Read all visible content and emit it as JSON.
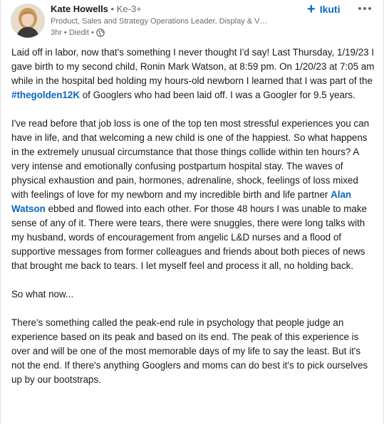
{
  "post": {
    "author": {
      "name": "Kate Howells",
      "degree": "• Ke-3+",
      "headline": "Product, Sales and Strategy Operations Leader, Display & Vide...",
      "time": "3hr",
      "edited": "• Diedit •",
      "avatar_icon": "profile-photo"
    },
    "follow_label": "Ikuti",
    "more_icon": "ellipsis-icon",
    "paragraphs": {
      "p1_a": "Laid off in labor, now that's something I never thought I'd say! Last Thursday, 1/19/23 I gave birth to my second child, Ronin Mark Watson, at 8:59 pm. On 1/20/23 at 7:05 am while in the hospital bed holding my hours-old newborn I learned that I was part of the ",
      "p1_hashtag": "#thegolden12K",
      "p1_b": " of Googlers who had been laid off. I was a Googler for 9.5 years.",
      "p2_a": "I've read before that job loss is one of the top ten most stressful experiences you can have in life, and that welcoming a new child is one of the happiest. So what happens in the extremely unusual circumstance that those things collide within ten hours? A very intense and emotionally confusing postpartum hospital stay. The waves of physical exhaustion and pain, hormones, adrenaline, shock, feelings of loss mixed with feelings of love for my newborn and my incredible birth and life partner ",
      "p2_mention": "Alan Watson",
      "p2_b": " ebbed and flowed into each other. For those 48 hours I was unable to make sense of any of it. There were tears, there were snuggles, there were long talks with my husband, words of encouragement from angelic L&D nurses and a flood of supportive messages from former colleagues and friends about both pieces of news that brought me back to tears. I let myself feel and process it all, no holding back.",
      "p3": "So what now...",
      "p4": "There's something called the peak-end rule in psychology that people judge an experience based on its peak and based on its end. The peak of this experience is over and will be one of the most memorable days of my life to say the least. But it's not the end. If there's anything Googlers and moms can do best it's to pick ourselves up by our bootstraps."
    },
    "colors": {
      "link": "#0a66c2",
      "text": "#1a1a1a",
      "muted": "#666666"
    }
  }
}
